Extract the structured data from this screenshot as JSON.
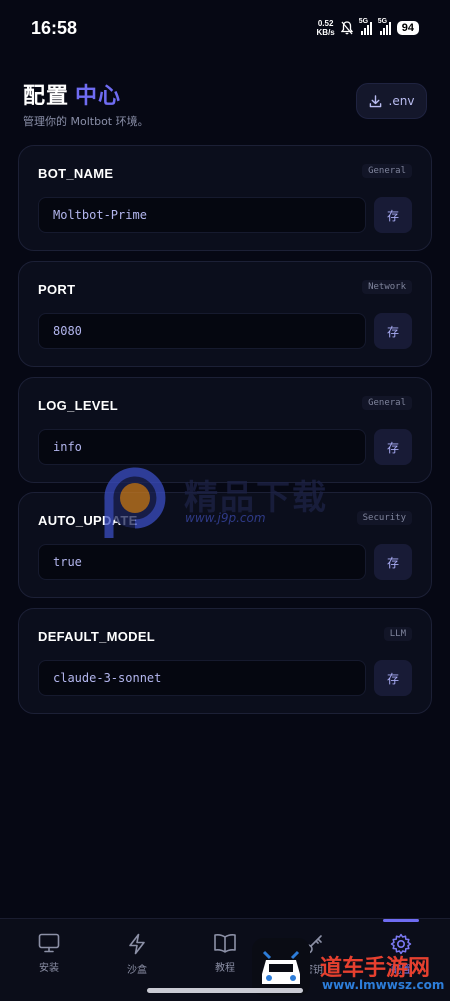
{
  "status": {
    "time": "16:58",
    "net_speed_value": "0.52",
    "net_speed_unit": "KB/s",
    "sim1": "5G",
    "sim2": "5G",
    "battery": "94"
  },
  "header": {
    "title": "配置",
    "title_accent": "中心",
    "subtitle": "管理你的 Moltbot 环境。",
    "env_button": ".env"
  },
  "configs": [
    {
      "key": "BOT_NAME",
      "tag": "General",
      "value": "Moltbot-Prime",
      "save": "存"
    },
    {
      "key": "PORT",
      "tag": "Network",
      "value": "8080",
      "save": "存"
    },
    {
      "key": "LOG_LEVEL",
      "tag": "General",
      "value": "info",
      "save": "存"
    },
    {
      "key": "AUTO_UPDATE",
      "tag": "Security",
      "value": "true",
      "save": "存"
    },
    {
      "key": "DEFAULT_MODEL",
      "tag": "LLM",
      "value": "claude-3-sonnet",
      "save": "存"
    }
  ],
  "nav": [
    {
      "label": "安装",
      "icon": "monitor-icon"
    },
    {
      "label": "沙盒",
      "icon": "lightning-icon"
    },
    {
      "label": "教程",
      "icon": "book-icon"
    },
    {
      "label": "密钥",
      "icon": "key-icon"
    },
    {
      "label": "配置",
      "icon": "gear-icon",
      "active": true
    }
  ],
  "watermark": {
    "text": "精品下载",
    "url": "www.j9p.com"
  },
  "badge": {
    "text": "道车手游网",
    "url": "www.lmwwsz.com"
  },
  "colors": {
    "background": "#060814",
    "accent": "#6f6cf2",
    "card": "#0b0e1c"
  }
}
